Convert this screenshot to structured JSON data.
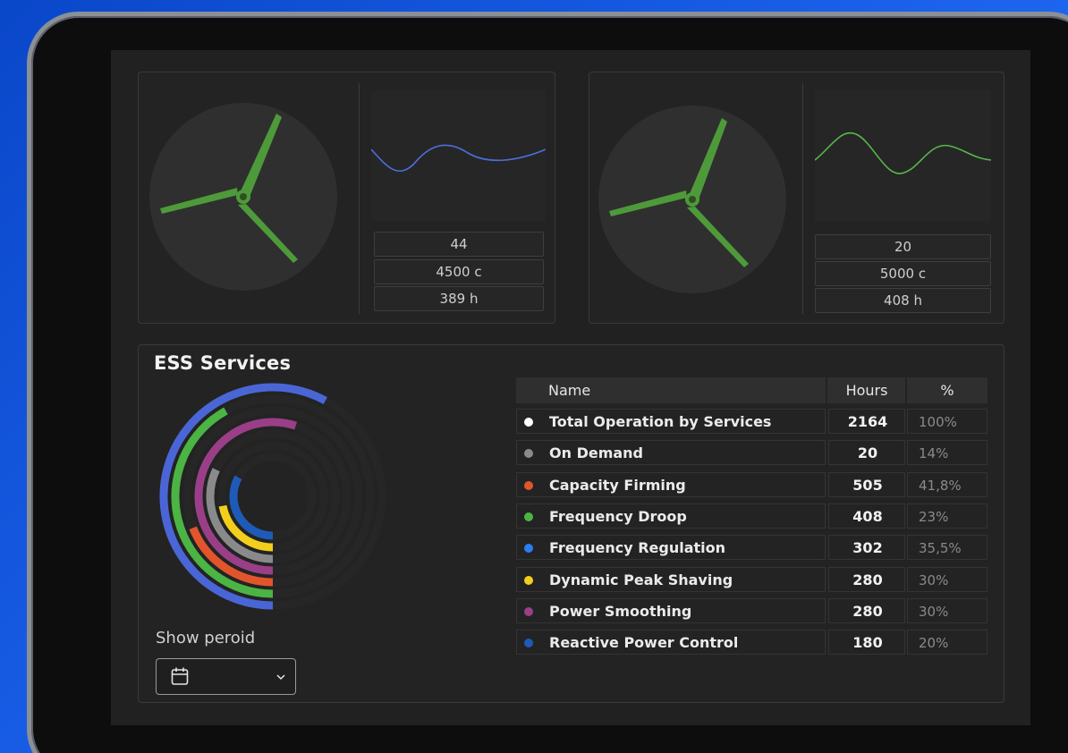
{
  "turbines": [
    {
      "stats": [
        "44",
        "4500 c",
        "389 h"
      ],
      "trend_color": "#4d6fe0"
    },
    {
      "stats": [
        "20",
        "5000 c",
        "408 h"
      ],
      "trend_color": "#57b84a"
    }
  ],
  "ess": {
    "title": "ESS Services",
    "period_label": "Show peroid",
    "table": {
      "headers": {
        "name": "Name",
        "hours": "Hours",
        "pct": "%"
      },
      "rows": [
        {
          "name": "Total Operation by Services",
          "hours": "2164",
          "pct": "100%",
          "color": "#ffffff"
        },
        {
          "name": "On Demand",
          "hours": "20",
          "pct": "14%",
          "color": "#8a8a8a"
        },
        {
          "name": "Capacity Firming",
          "hours": "505",
          "pct": "41,8%",
          "color": "#e2552c"
        },
        {
          "name": "Frequency Droop",
          "hours": "408",
          "pct": "23%",
          "color": "#4bb444"
        },
        {
          "name": "Frequency Regulation",
          "hours": "302",
          "pct": "35,5%",
          "color": "#2b7cf3"
        },
        {
          "name": "Dynamic Peak Shaving",
          "hours": "280",
          "pct": "30%",
          "color": "#f2cf1c"
        },
        {
          "name": "Power Smoothing",
          "hours": "280",
          "pct": "30%",
          "color": "#9a3f87"
        },
        {
          "name": "Reactive Power Control",
          "hours": "180",
          "pct": "20%",
          "color": "#1e5bb8"
        }
      ]
    },
    "rings": [
      {
        "label": "Total Operation by Services",
        "fraction": 0.58,
        "color": "#4a66d6"
      },
      {
        "label": "Frequency Droop",
        "fraction": 0.42,
        "color": "#4bb444"
      },
      {
        "label": "Capacity Firming",
        "fraction": 0.19,
        "color": "#e2552c"
      },
      {
        "label": "Power Smoothing",
        "fraction": 0.55,
        "color": "#9a3f87"
      },
      {
        "label": "On Demand",
        "fraction": 0.32,
        "color": "#8a8a8a"
      },
      {
        "label": "Dynamic Peak Shaving",
        "fraction": 0.22,
        "color": "#f2cf1c"
      },
      {
        "label": "Reactive Power Control",
        "fraction": 0.33,
        "color": "#1e5bb8"
      }
    ]
  },
  "colors": {
    "blade": "#4e9a3a",
    "background": "#212121"
  }
}
